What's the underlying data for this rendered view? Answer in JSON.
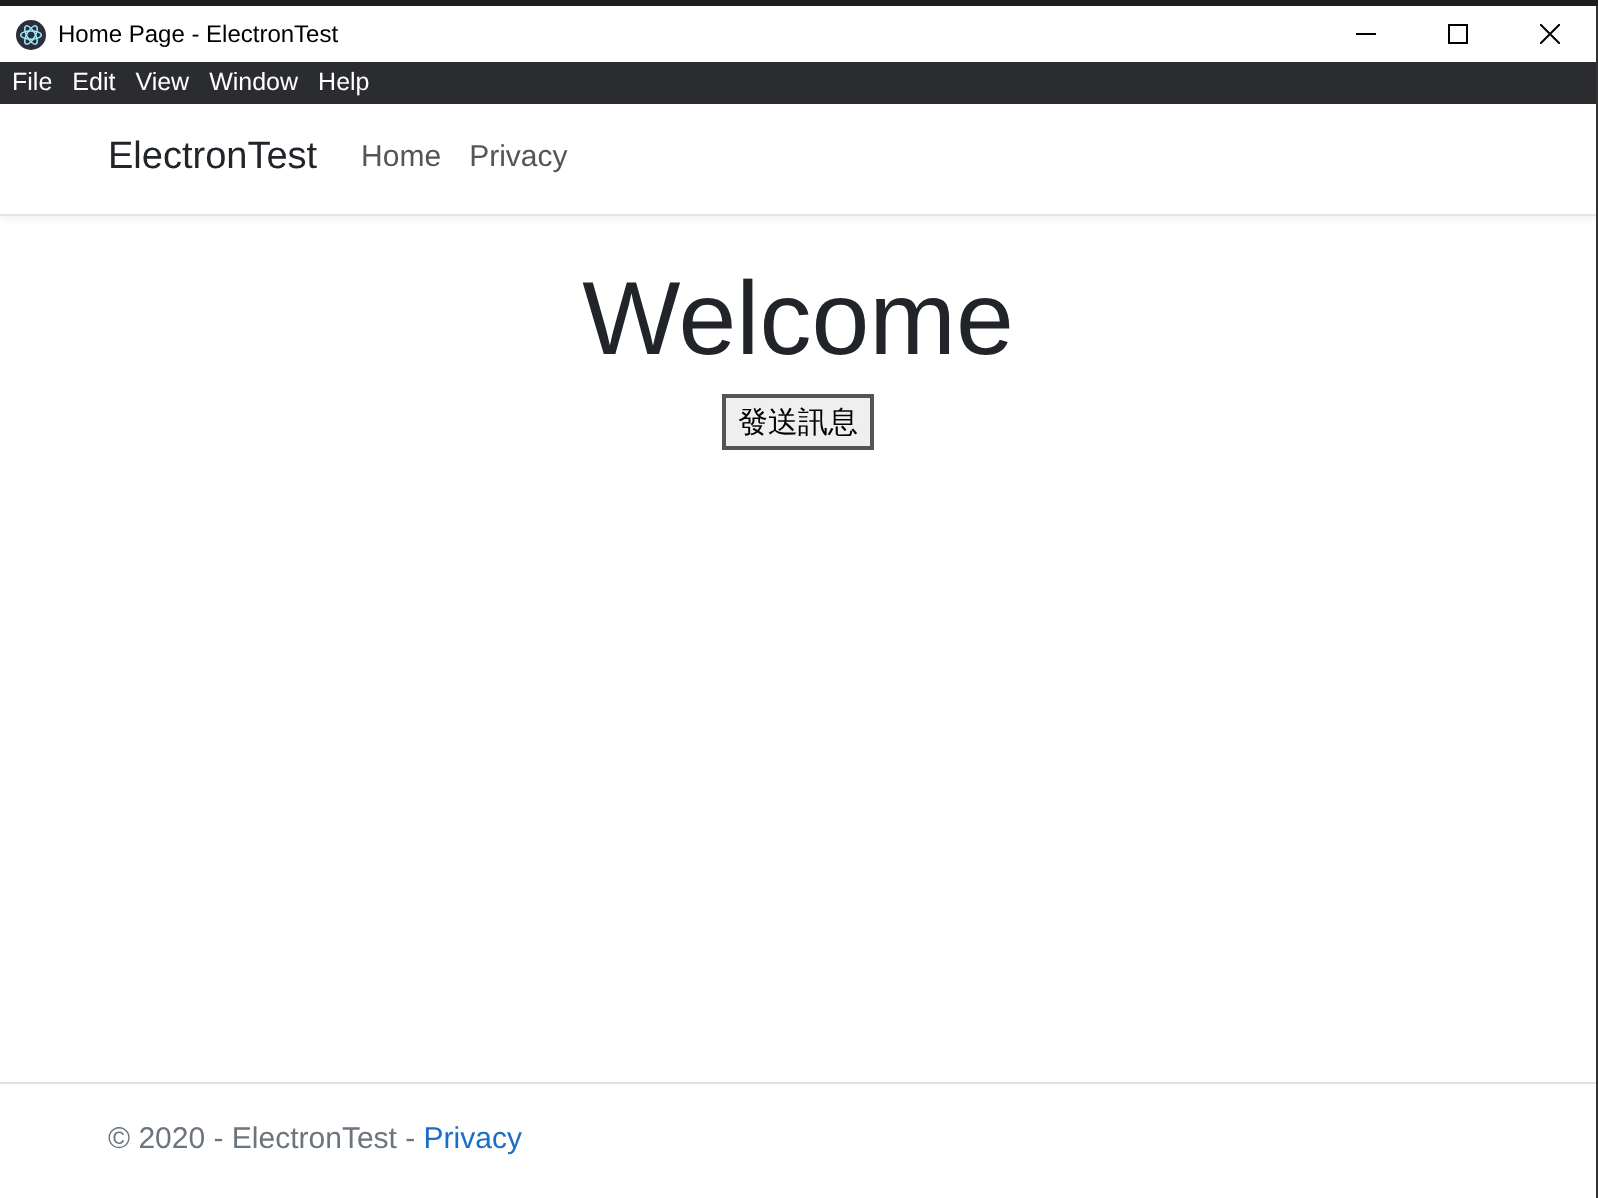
{
  "window": {
    "title": "Home Page - ElectronTest"
  },
  "menu_bar": [
    {
      "label": "File"
    },
    {
      "label": "Edit"
    },
    {
      "label": "View"
    },
    {
      "label": "Window"
    },
    {
      "label": "Help"
    }
  ],
  "navbar": {
    "brand": "ElectronTest",
    "links": [
      {
        "label": "Home"
      },
      {
        "label": "Privacy"
      }
    ]
  },
  "main": {
    "heading": "Welcome",
    "button": "發送訊息"
  },
  "footer": {
    "text": "© 2020 - ElectronTest - ",
    "link": "Privacy"
  }
}
